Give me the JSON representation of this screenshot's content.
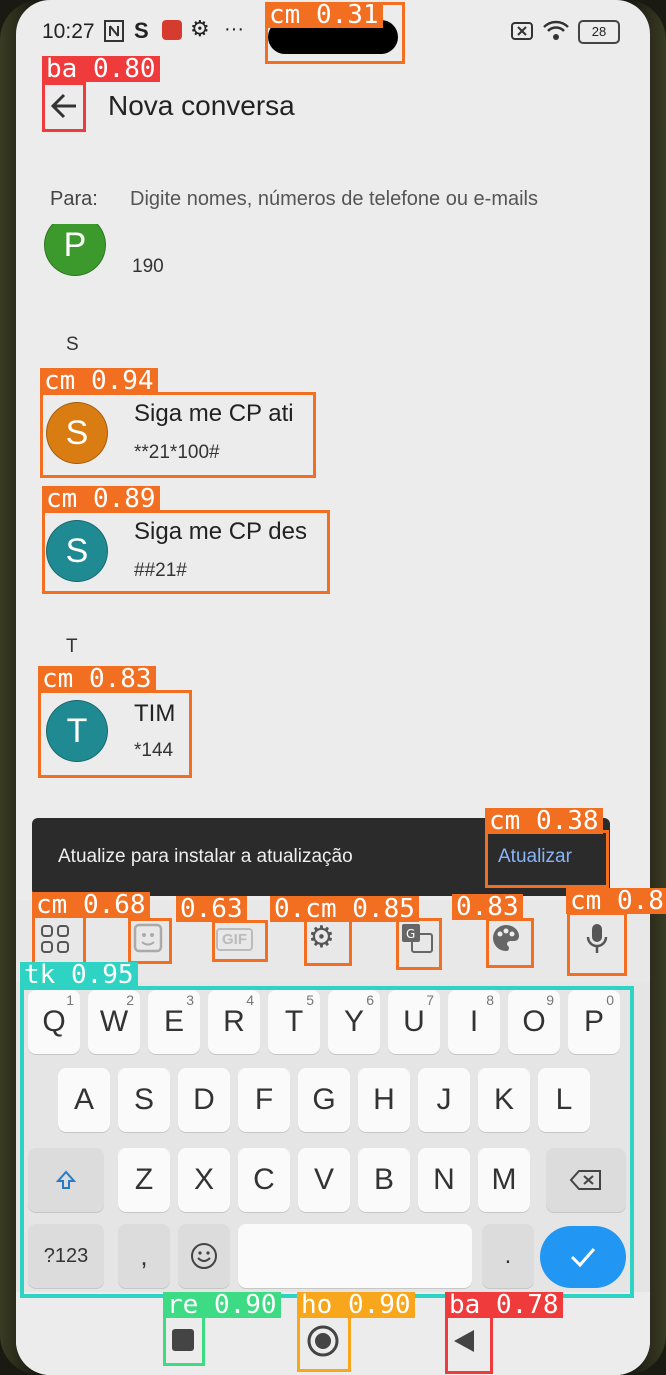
{
  "status": {
    "time": "10:27",
    "icons_left": [
      "nfc-icon",
      "s-icon",
      "mail-icon",
      "gear-icon",
      "more-icon"
    ],
    "more": "···",
    "battery": "28"
  },
  "header": {
    "title": "Nova conversa"
  },
  "recipient": {
    "label": "Para:",
    "placeholder": "Digite nomes, números de telefone ou e-mails"
  },
  "contacts": {
    "partial": {
      "initial": "P",
      "number": "190",
      "color": "#3c9a2c"
    },
    "section_s": "S",
    "section_t": "T",
    "items": [
      {
        "initial": "S",
        "name": "Siga me CP ati",
        "number": "**21*100#",
        "color": "#d97c12"
      },
      {
        "initial": "S",
        "name": "Siga me CP des",
        "number": "##21#",
        "color": "#208a92"
      },
      {
        "initial": "T",
        "name": "TIM",
        "number": "*144",
        "color": "#208a92"
      }
    ]
  },
  "snackbar": {
    "message": "Atualize para instalar a atualização",
    "action": "Atualizar"
  },
  "keyboard": {
    "row1": [
      "Q",
      "W",
      "E",
      "R",
      "T",
      "Y",
      "U",
      "I",
      "O",
      "P"
    ],
    "row1_hints": [
      "1",
      "2",
      "3",
      "4",
      "5",
      "6",
      "7",
      "8",
      "9",
      "0"
    ],
    "row2": [
      "A",
      "S",
      "D",
      "F",
      "G",
      "H",
      "J",
      "K",
      "L"
    ],
    "row3": [
      "Z",
      "X",
      "C",
      "V",
      "B",
      "N",
      "M"
    ],
    "symbols": "?123",
    "comma": ",",
    "period": "."
  },
  "detections": {
    "cm031": "cm 0.31",
    "ba080": "ba 0.80",
    "cm094": "cm 0.94",
    "cm089": "cm 0.89",
    "cm083": "cm 0.83",
    "cm038": "cm 0.38",
    "cm068": "cm 0.68",
    "t063": "0.63",
    "cm085": "0.cm 0.85",
    "t083": "0.83",
    "cm08": "cm 0.8",
    "tk095": "tk 0.95",
    "re090": "re 0.90",
    "ho090": "ho 0.90",
    "ba078": "ba 0.78"
  },
  "colors": {
    "orange": "#f26f22",
    "red": "#ef3b3b",
    "teal": "#2fd3c3",
    "green": "#3ddc84",
    "yellow": "#f8a71c",
    "action": "#8ab4f8",
    "enter": "#2196f3"
  }
}
